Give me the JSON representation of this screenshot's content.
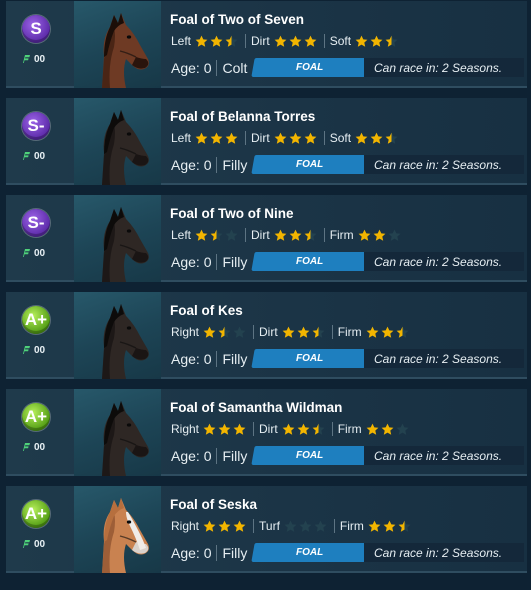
{
  "colors": {
    "star_filled": "#f2b500",
    "star_empty": "#23424f",
    "stage_badge": "#1e7fbf",
    "grade_purple": "#6a33b8",
    "grade_green": "#6cbd1e"
  },
  "horses": [
    {
      "grade": "S",
      "grade_color": "purple",
      "points": "00",
      "coat": "bay",
      "name": "Foal of Two of Seven",
      "aptitudes": [
        {
          "label": "Left",
          "stars": 2.5
        },
        {
          "label": "Dirt",
          "stars": 3
        },
        {
          "label": "Soft",
          "stars": 2.5
        }
      ],
      "age": "Age: 0",
      "sex": "Colt",
      "stage": "FOAL",
      "race_info": "Can race in: 2 Seasons."
    },
    {
      "grade": "S-",
      "grade_color": "purple",
      "points": "00",
      "coat": "black",
      "name": "Foal of Belanna Torres",
      "aptitudes": [
        {
          "label": "Left",
          "stars": 3
        },
        {
          "label": "Dirt",
          "stars": 3
        },
        {
          "label": "Soft",
          "stars": 2.5
        }
      ],
      "age": "Age: 0",
      "sex": "Filly",
      "stage": "FOAL",
      "race_info": "Can race in: 2 Seasons."
    },
    {
      "grade": "S-",
      "grade_color": "purple",
      "points": "00",
      "coat": "black",
      "name": "Foal of Two of Nine",
      "aptitudes": [
        {
          "label": "Left",
          "stars": 1.5
        },
        {
          "label": "Dirt",
          "stars": 2.5
        },
        {
          "label": "Firm",
          "stars": 2
        }
      ],
      "age": "Age: 0",
      "sex": "Filly",
      "stage": "FOAL",
      "race_info": "Can race in: 2 Seasons."
    },
    {
      "grade": "A+",
      "grade_color": "green",
      "points": "00",
      "coat": "black",
      "name": "Foal of Kes",
      "aptitudes": [
        {
          "label": "Right",
          "stars": 1.5
        },
        {
          "label": "Dirt",
          "stars": 2.5
        },
        {
          "label": "Firm",
          "stars": 2.5
        }
      ],
      "age": "Age: 0",
      "sex": "Filly",
      "stage": "FOAL",
      "race_info": "Can race in: 2 Seasons."
    },
    {
      "grade": "A+",
      "grade_color": "green",
      "points": "00",
      "coat": "black",
      "name": "Foal of Samantha Wildman",
      "aptitudes": [
        {
          "label": "Right",
          "stars": 3
        },
        {
          "label": "Dirt",
          "stars": 2.5
        },
        {
          "label": "Firm",
          "stars": 2
        }
      ],
      "age": "Age: 0",
      "sex": "Filly",
      "stage": "FOAL",
      "race_info": "Can race in: 2 Seasons."
    },
    {
      "grade": "A+",
      "grade_color": "green",
      "points": "00",
      "coat": "chestnut-blaze",
      "name": "Foal of Seska",
      "aptitudes": [
        {
          "label": "Right",
          "stars": 3
        },
        {
          "label": "Turf",
          "stars": 0
        },
        {
          "label": "Firm",
          "stars": 2.5
        }
      ],
      "age": "Age: 0",
      "sex": "Filly",
      "stage": "FOAL",
      "race_info": "Can race in: 2 Seasons."
    }
  ]
}
